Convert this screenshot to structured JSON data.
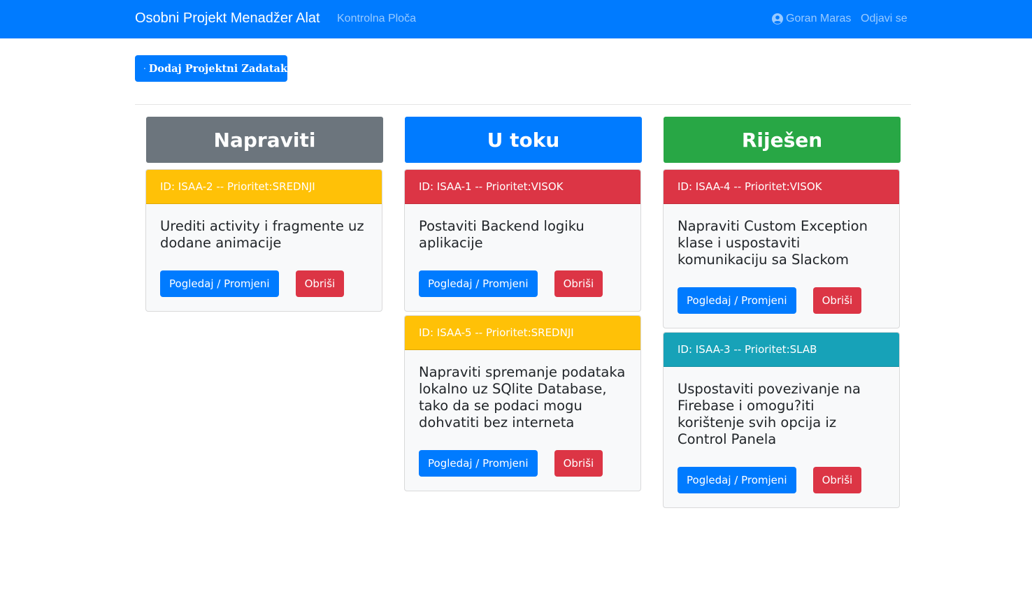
{
  "navbar": {
    "brand": "Osobni Projekt Menadžer Alat",
    "dashboard": "Kontrolna Ploča",
    "user": "Goran Maras",
    "logout": "Odjavi se"
  },
  "toolbar": {
    "add_label": "Dodaj Projektni Zadatak"
  },
  "columns": [
    {
      "title": "Napraviti",
      "color": "#6c757d"
    },
    {
      "title": "U toku",
      "color": "#007bff"
    },
    {
      "title": "Riješen",
      "color": "#28a745"
    }
  ],
  "cards": [
    {
      "header": "ID: ISAA-2 -- Prioritet:SREDNJI",
      "color": "#ffc107",
      "title": "Urediti activity i fragmente uz dodane animacije"
    },
    {
      "header": "ID: ISAA-1 -- Prioritet:VISOK",
      "color": "#dc3545",
      "title": "Postaviti Backend logiku aplikacije"
    },
    {
      "header": "ID: ISAA-5 -- Prioritet:SREDNJI",
      "color": "#ffc107",
      "title": "Napraviti spremanje podataka lokalno uz SQlite Database, tako da se podaci mogu dohvatiti bez interneta"
    },
    {
      "header": "ID: ISAA-4 -- Prioritet:VISOK",
      "color": "#dc3545",
      "title": "Napraviti Custom Exception klase i uspostaviti komunikaciju sa Slackom"
    },
    {
      "header": "ID: ISAA-3 -- Prioritet:SLAB",
      "color": "#17a2b8",
      "title": "Uspostaviti povezivanje na Firebase i omogu?iti korištenje svih opcija iz Control Panela"
    }
  ],
  "buttons": {
    "view": "Pogledaj / Promjeni",
    "delete": "Obriši"
  }
}
